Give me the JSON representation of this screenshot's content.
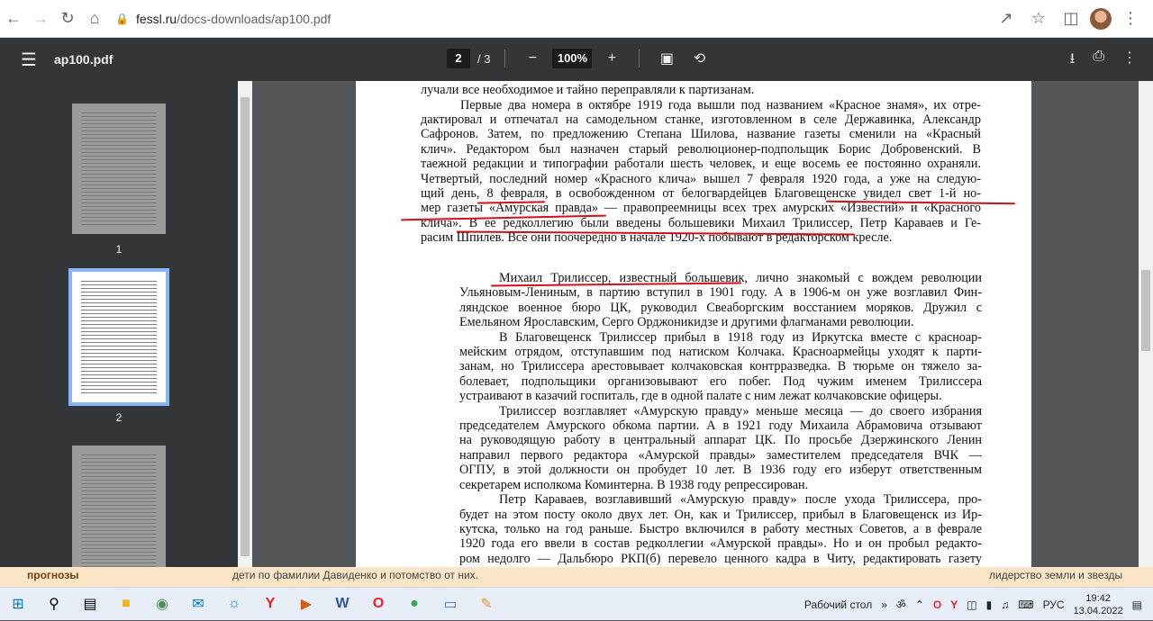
{
  "browser": {
    "url_host": "fessl.ru",
    "url_path": "/docs-downloads/ap100.pdf"
  },
  "pdf": {
    "title": "ap100.pdf",
    "current_page": "2",
    "total_pages": "/ 3",
    "zoom": "100%",
    "thumbnails": [
      "1",
      "2"
    ]
  },
  "document": {
    "lines": [
      "лучали все необходимое и тайно переправляли к партизанам.",
      "Первые два номера в октябре 1919 года вышли под названием «Красное знамя», их отре-",
      "дактировал и отпечатал на самодельном станке, изготовленном в селе Державинка, Александр",
      "Сафронов. Затем, по предложению Степана Шилова, название газеты сменили на «Красный",
      "клич». Редактором был назначен старый революционер-подпольщик Борис Добровенский. В",
      "таежной редакции и типографии работали шесть человек, и еще восемь ее постоянно охраняли.",
      "Четвертый, последний номер «Красного клича» вышел 7 февраля 1920 года, а уже на следую-",
      "щий день, 8 февраля, в освобожденном от белогвардейцев Благовещенске увидел свет 1-й но-",
      "мер газеты «Амурская правда» — правопреемницы всех трех амурских «Известий» и «Красного",
      "клича». В ее редколлегию были введены большевики Михаил Трилиссер, Петр Караваев и Ге-",
      "расим Шпилев. Все они поочередно в начале 1920-х побывают в редакторском кресле."
    ],
    "lines2": [
      "Михаил Трилиссер, известный большевик, лично знакомый с вождем революции",
      "Ульяновым-Лениным, в партию вступил в 1901 году. А в 1906-м он уже возглавил Фин-",
      "ляндское военное бюро ЦК, руководил Свеаборгским восстанием моряков. Дружил с",
      "Емельяном Ярославским, Серго Орджоникидзе и другими флагманами революции.",
      "В Благовещенск Трилиссер прибыл в 1918 году из Иркутска вместе с красноар-",
      "мейским отрядом, отступавшим под натиском Колчака. Красноармейцы уходят к парти-",
      "занам, но Трилиссера арестовывает колчаковская контрразведка. В тюрьме он тяжело за-",
      "болевает, подпольщики организовывают его побег. Под чужим именем Трилиссера",
      "устраивают в казачий госпиталь, где в одной палате с ним лежат колчаковские офицеры.",
      "Трилиссер возглавляет «Амурскую правду» меньше месяца — до своего избрания",
      "председателем Амурского обкома партии. А в 1921 году Михаила Абрамовича отзывают",
      "на руководящую работу в центральный аппарат ЦК. По просьбе Дзержинского Ленин",
      "направил первого редактора «Амурской правды» заместителем председателя ВЧК —",
      "ОГПУ, в этой должности он пробудет 10 лет. В 1936 году его изберут ответственным",
      "секретарем исполкома Коминтерна. В 1938 году репрессирован.",
      "Петр Караваев, возглавивший «Амурскую правду» после ухода Трилиссера, про-",
      "будет на этом посту около двух лет. Он, как и Трилиссер, прибыл в Благовещенск из Ир-",
      "кутска, только на год раньше. Быстро включился в работу местных Советов, а в феврале",
      "1920 года его ввели в состав редколлегии «Амурской правды». Но и он пробыл редакто-",
      "ром недолго — Дальбюро РКП(б) перевело ценного кадра в Читу, редактировать газету"
    ]
  },
  "background": {
    "left_text": "прогнозы",
    "mid_text": "дети по фамилии Давиденко и потомство от них.",
    "right_text": "лидерство земли и звезды"
  },
  "taskbar": {
    "desktop_label": "Рабочий стол",
    "lang": "РУС",
    "time": "19:42",
    "date": "13.04.2022"
  },
  "colors": {
    "underline": "#d0101a",
    "toolbar": "#323639",
    "viewer_bg": "#525659"
  }
}
